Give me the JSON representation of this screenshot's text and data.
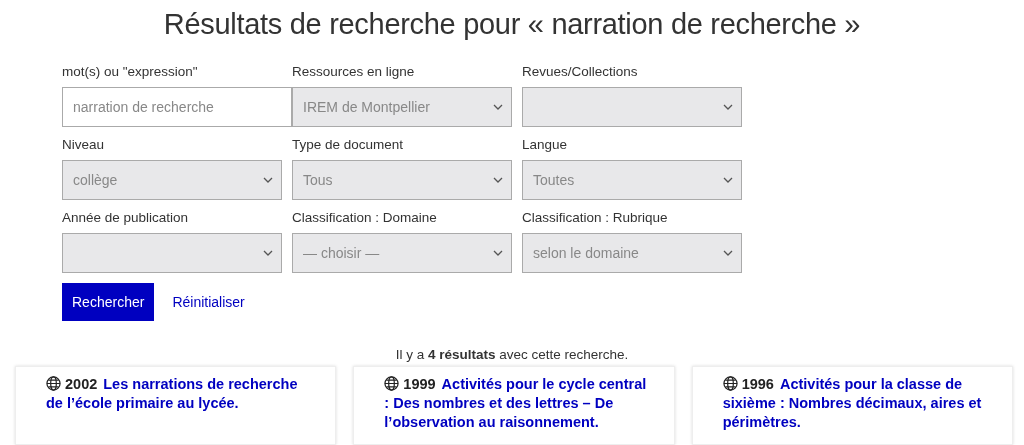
{
  "title": "Résultats de recherche pour « narration de recherche »",
  "fields": [
    {
      "kind": "text",
      "label": "mot(s) ou \"expression\"",
      "placeholder": "narration de recherche"
    },
    {
      "kind": "select",
      "label": "Ressources en ligne",
      "value": "IREM de Montpellier"
    },
    {
      "kind": "select",
      "label": "Revues/Collections"
    },
    {
      "kind": "select",
      "label": "Niveau",
      "value": "collège"
    },
    {
      "kind": "select",
      "label": "Type de document",
      "value": "Tous"
    },
    {
      "kind": "select",
      "label": "Langue",
      "value": "Toutes"
    },
    {
      "kind": "select",
      "label": "Année de publication"
    },
    {
      "kind": "select",
      "label": "Classification : Domaine",
      "value": "— choisir —"
    },
    {
      "kind": "select",
      "label": "Classification : Rubrique",
      "value": "selon le domaine"
    }
  ],
  "buttons": {
    "submit": "Rechercher",
    "reset": "Réinitialiser"
  },
  "summary": "Il y a **4 résultats** avec cette recherche.",
  "results": [
    {
      "year": "2002",
      "title": "Les narrations de recherche de l’école primaire au lycée."
    },
    {
      "year": "1999",
      "title": "Activités pour le cycle central : Des nombres et des lettres – De l’observation au raisonnement."
    },
    {
      "year": "1996",
      "title": "Activités pour la classe de sixième : Nombres décimaux, aires et périmètres."
    }
  ]
}
